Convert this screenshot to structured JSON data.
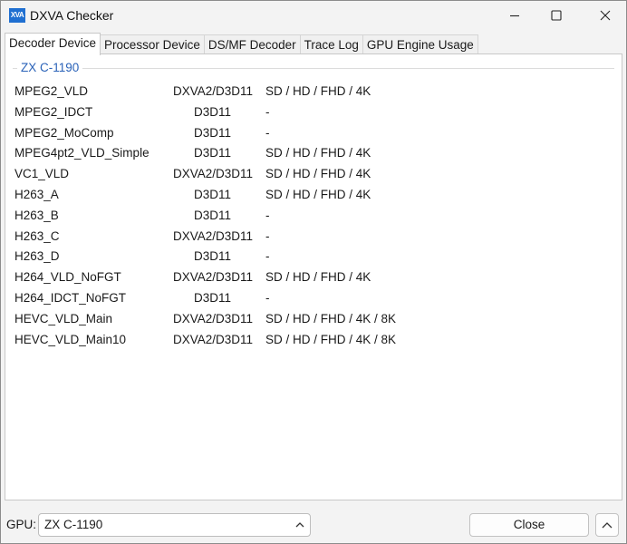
{
  "window": {
    "title": "DXVA Checker",
    "icon_text": "XVA",
    "controls": [
      "minimize-icon",
      "maximize-icon",
      "close-icon"
    ]
  },
  "tabs": [
    {
      "label": "Decoder Device",
      "active": true
    },
    {
      "label": "Processor Device",
      "active": false
    },
    {
      "label": "DS/MF Decoder",
      "active": false
    },
    {
      "label": "Trace Log",
      "active": false
    },
    {
      "label": "GPU Engine Usage",
      "active": false
    }
  ],
  "group": {
    "label": "ZX C-1190",
    "color": "#2a62b8"
  },
  "decoders": [
    {
      "name": "MPEG2_VLD",
      "api": "DXVA2/D3D11",
      "resolutions": "SD / HD / FHD / 4K"
    },
    {
      "name": "MPEG2_IDCT",
      "api": "D3D11",
      "resolutions": "-"
    },
    {
      "name": "MPEG2_MoComp",
      "api": "D3D11",
      "resolutions": "-"
    },
    {
      "name": "MPEG4pt2_VLD_Simple",
      "api": "D3D11",
      "resolutions": "SD / HD / FHD / 4K"
    },
    {
      "name": "VC1_VLD",
      "api": "DXVA2/D3D11",
      "resolutions": "SD / HD / FHD / 4K"
    },
    {
      "name": "H263_A",
      "api": "D3D11",
      "resolutions": "SD / HD / FHD / 4K"
    },
    {
      "name": "H263_B",
      "api": "D3D11",
      "resolutions": "-"
    },
    {
      "name": "H263_C",
      "api": "DXVA2/D3D11",
      "resolutions": "-"
    },
    {
      "name": "H263_D",
      "api": "D3D11",
      "resolutions": "-"
    },
    {
      "name": "H264_VLD_NoFGT",
      "api": "DXVA2/D3D11",
      "resolutions": "SD / HD / FHD / 4K"
    },
    {
      "name": "H264_IDCT_NoFGT",
      "api": "D3D11",
      "resolutions": "-"
    },
    {
      "name": "HEVC_VLD_Main",
      "api": "DXVA2/D3D11",
      "resolutions": "SD / HD / FHD / 4K / 8K"
    },
    {
      "name": "HEVC_VLD_Main10",
      "api": "DXVA2/D3D11",
      "resolutions": "SD / HD / FHD / 4K / 8K"
    }
  ],
  "footer": {
    "gpu_label": "GPU:",
    "gpu_value": "ZX C-1190",
    "close_label": "Close",
    "gpu_chevron_icon": "chevron-up-icon",
    "up_icon": "chevron-up-icon"
  }
}
